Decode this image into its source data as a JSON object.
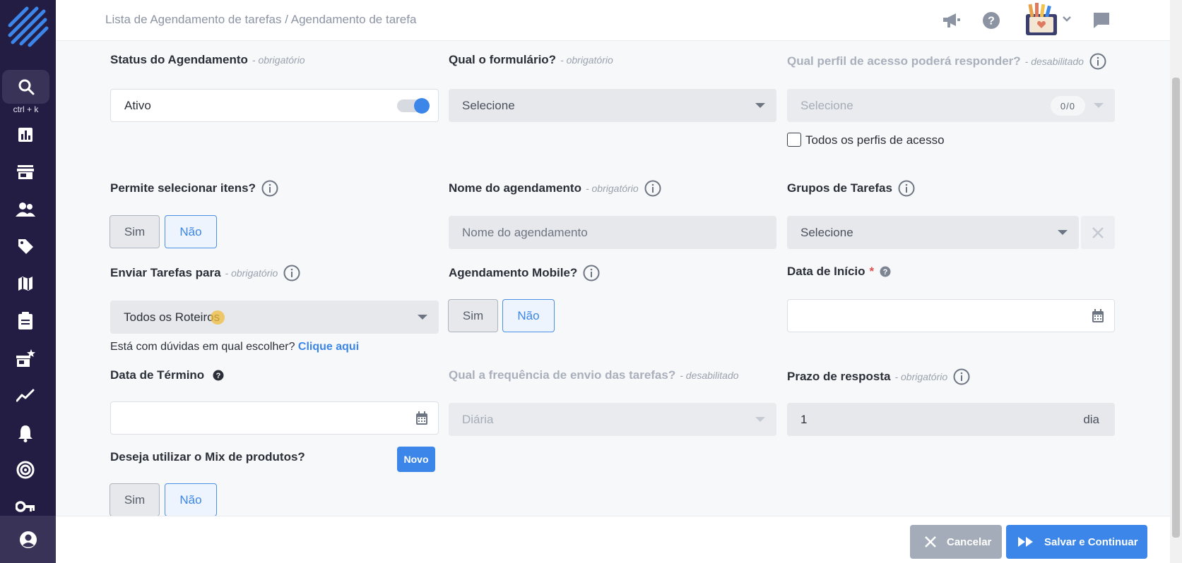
{
  "sidebar": {
    "shortcut": "ctrl + k",
    "items": [
      {
        "icon": "chart-icon"
      },
      {
        "icon": "store-icon"
      },
      {
        "icon": "users-icon"
      },
      {
        "icon": "tag-icon"
      },
      {
        "icon": "map-icon"
      },
      {
        "icon": "clipboard-icon"
      },
      {
        "icon": "store-star-icon"
      },
      {
        "icon": "trend-icon"
      },
      {
        "icon": "bell-icon"
      },
      {
        "icon": "target-icon"
      },
      {
        "icon": "key-icon"
      }
    ]
  },
  "header": {
    "breadcrumb_parent": "Lista de Agendamento de tarefas",
    "breadcrumb_sep": " / ",
    "breadcrumb_current": "Agendamento de tarefa"
  },
  "form": {
    "required_tag": "- obrigatório",
    "disabled_tag": "- desabilitado",
    "status": {
      "label": "Status do Agendamento",
      "value": "Ativo"
    },
    "form_select": {
      "label": "Qual o formulário?",
      "value": "Selecione"
    },
    "profile": {
      "label": "Qual perfil de acesso poderá responder?",
      "value": "Selecione",
      "count": "0/0",
      "all_label": "Todos os perfis de acesso"
    },
    "select_items": {
      "label": "Permite selecionar itens?",
      "yes": "Sim",
      "no": "Não"
    },
    "schedule_name": {
      "label": "Nome do agendamento",
      "placeholder": "Nome do agendamento"
    },
    "task_groups": {
      "label": "Grupos de Tarefas",
      "value": "Selecione"
    },
    "send_to": {
      "label": "Enviar Tarefas para",
      "value": "Todos os Roteiros",
      "help_text": "Está com dúvidas em qual escolher?",
      "help_link": "Clique aqui"
    },
    "mobile": {
      "label": "Agendamento Mobile?",
      "yes": "Sim",
      "no": "Não"
    },
    "start_date": {
      "label": "Data de Início",
      "star": "*"
    },
    "end_date": {
      "label": "Data de Término"
    },
    "frequency": {
      "label": "Qual a frequência de envio das tarefas?",
      "value": "Diária"
    },
    "deadline": {
      "label": "Prazo de resposta",
      "value": "1",
      "unit": "dia"
    },
    "mix": {
      "label": "Deseja utilizar o Mix de produtos?",
      "badge": "Novo",
      "yes": "Sim",
      "no": "Não"
    }
  },
  "footer": {
    "cancel": "Cancelar",
    "save": "Salvar e Continuar"
  },
  "colors": {
    "sidebar": "#231c43",
    "accent": "#3b86e8",
    "required_star": "#e0504e"
  }
}
